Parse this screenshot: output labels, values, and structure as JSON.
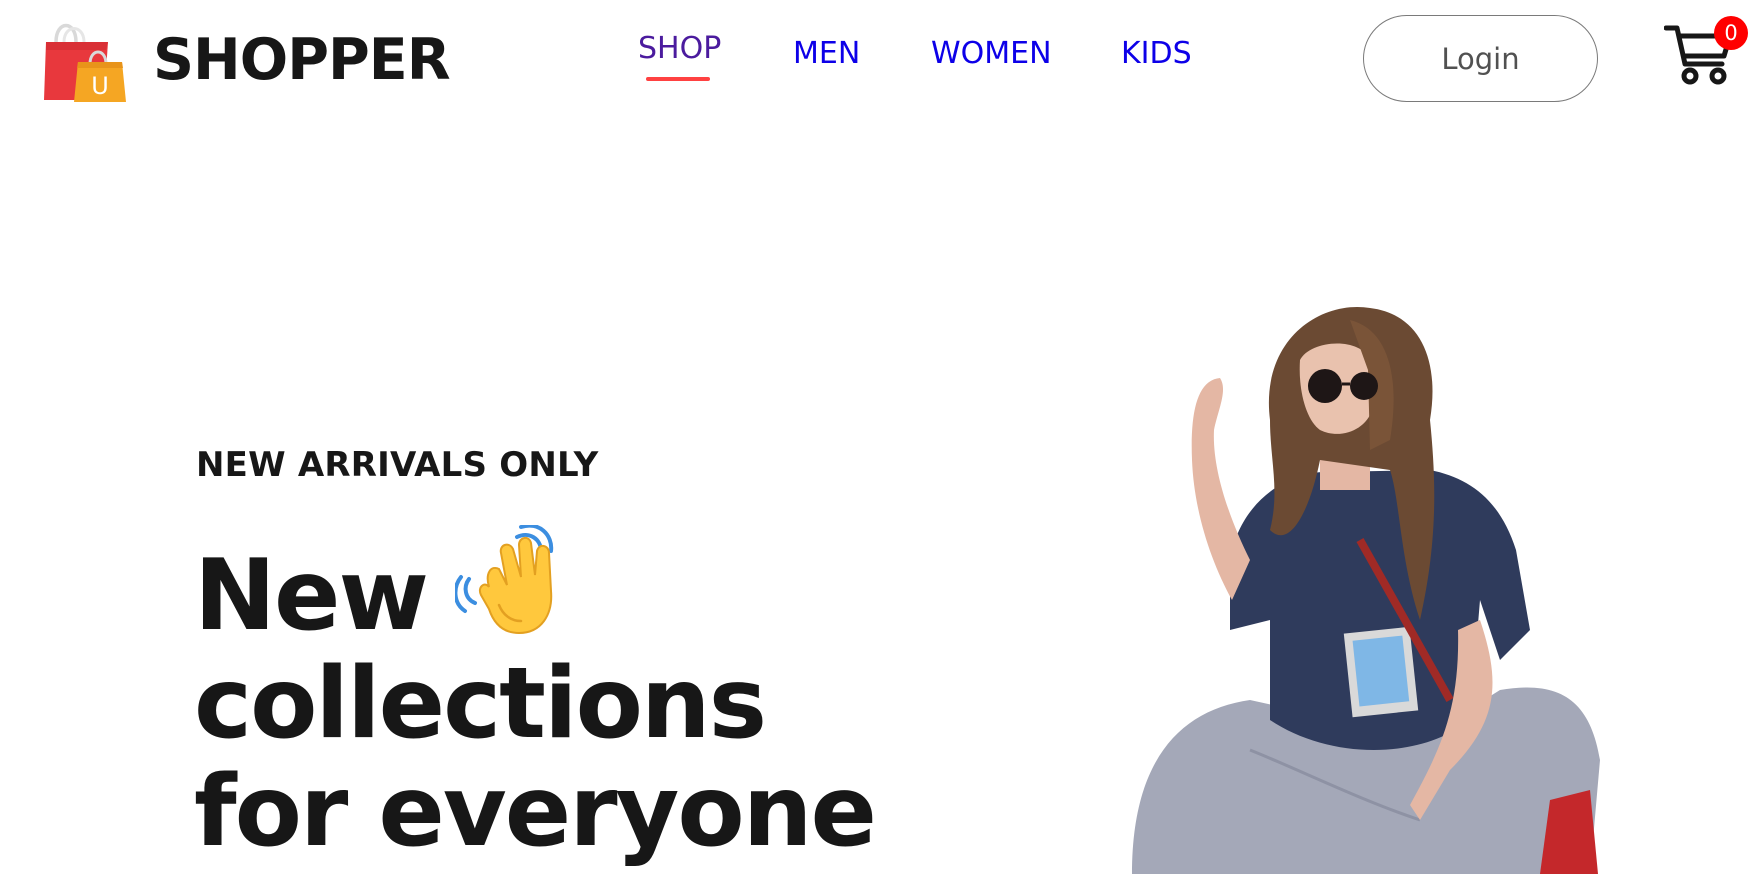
{
  "navbar": {
    "brand": "SHOPPER",
    "menu": [
      {
        "label": "SHOP",
        "active": true
      },
      {
        "label": "MEN",
        "active": false
      },
      {
        "label": "WOMEN",
        "active": false
      },
      {
        "label": "KIDS",
        "active": false
      }
    ],
    "login_label": "Login",
    "cart_count": "0"
  },
  "hero": {
    "tag": "NEW ARRIVALS ONLY",
    "title_lines": [
      "New",
      "collections",
      "for everyone"
    ]
  },
  "colors": {
    "nav_link": "#0d00e8",
    "nav_active": "#4b1b9e",
    "underline": "#ff4141",
    "cart_badge": "#ff0000",
    "text_dark": "#171717"
  },
  "icons": {
    "logo": "shopping-bags-icon",
    "wave": "waving-hand-icon",
    "cart": "shopping-cart-icon"
  }
}
